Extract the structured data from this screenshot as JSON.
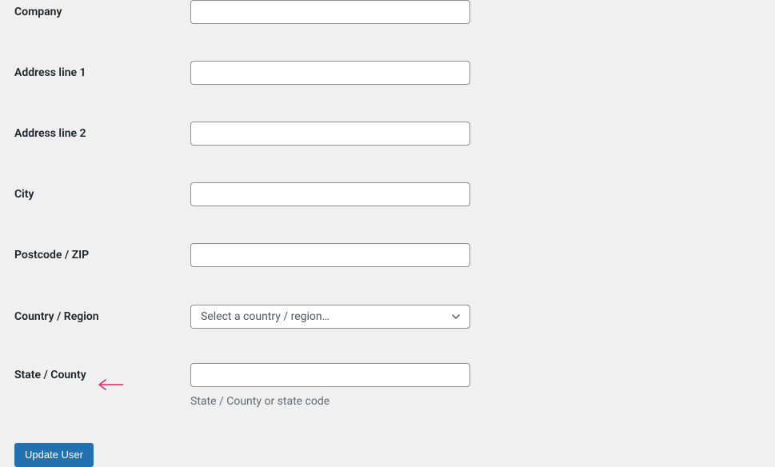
{
  "fields": {
    "company": {
      "label": "Company",
      "value": ""
    },
    "address1": {
      "label": "Address line 1",
      "value": ""
    },
    "address2": {
      "label": "Address line 2",
      "value": ""
    },
    "city": {
      "label": "City",
      "value": ""
    },
    "postcode": {
      "label": "Postcode / ZIP",
      "value": ""
    },
    "country": {
      "label": "Country / Region",
      "placeholder": "Select a country / region…"
    },
    "state": {
      "label": "State / County",
      "value": "",
      "helper": "State / County or state code"
    }
  },
  "submit": {
    "label": "Update User"
  }
}
